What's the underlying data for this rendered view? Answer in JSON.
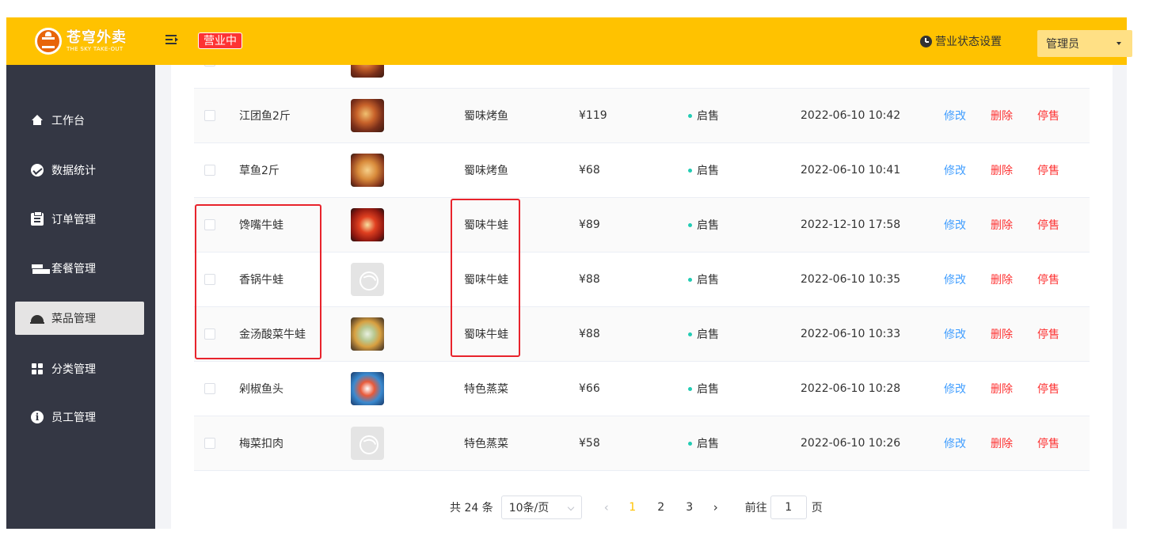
{
  "header": {
    "logo_cn": "苍穹外卖",
    "logo_en": "THE SKY TAKE-OUT",
    "status_tag": "营业中",
    "biz_setting_label": "营业状态设置",
    "user_label": "管理员",
    "bg_color": "#ffc200"
  },
  "sidebar": {
    "items": [
      {
        "label": "工作台",
        "icon": "home-icon"
      },
      {
        "label": "数据统计",
        "icon": "chart-icon"
      },
      {
        "label": "订单管理",
        "icon": "clipboard-icon"
      },
      {
        "label": "套餐管理",
        "icon": "gift-icon"
      },
      {
        "label": "菜品管理",
        "icon": "dish-cover-icon",
        "active": true
      },
      {
        "label": "分类管理",
        "icon": "grid-icon"
      },
      {
        "label": "员工管理",
        "icon": "info-icon"
      }
    ]
  },
  "table": {
    "rows": [
      {
        "name": "江团鱼2斤",
        "category": "蜀味烤鱼",
        "price": "¥119",
        "status": "启售",
        "updated": "2022-06-10 10:42",
        "image": "food"
      },
      {
        "name": "草鱼2斤",
        "category": "蜀味烤鱼",
        "price": "¥68",
        "status": "启售",
        "updated": "2022-06-10 10:41",
        "image": "food"
      },
      {
        "name": "馋嘴牛蛙",
        "category": "蜀味牛蛙",
        "price": "¥89",
        "status": "启售",
        "updated": "2022-12-10 17:58",
        "image": "food"
      },
      {
        "name": "香锅牛蛙",
        "category": "蜀味牛蛙",
        "price": "¥88",
        "status": "启售",
        "updated": "2022-06-10 10:35",
        "image": "placeholder"
      },
      {
        "name": "金汤酸菜牛蛙",
        "category": "蜀味牛蛙",
        "price": "¥88",
        "status": "启售",
        "updated": "2022-06-10 10:33",
        "image": "food"
      },
      {
        "name": "剁椒鱼头",
        "category": "特色蒸菜",
        "price": "¥66",
        "status": "启售",
        "updated": "2022-06-10 10:28",
        "image": "food"
      },
      {
        "name": "梅菜扣肉",
        "category": "特色蒸菜",
        "price": "¥58",
        "status": "启售",
        "updated": "2022-06-10 10:26",
        "image": "placeholder"
      }
    ],
    "ops": {
      "edit": "修改",
      "delete": "删除",
      "stop": "停售"
    }
  },
  "pagination": {
    "total": "共 24 条",
    "page_size": "10条/页",
    "pages": [
      "1",
      "2",
      "3"
    ],
    "current": "1",
    "goto_label": "前往",
    "goto_value": "1",
    "page_unit": "页",
    "prev": "‹",
    "next": "›"
  }
}
